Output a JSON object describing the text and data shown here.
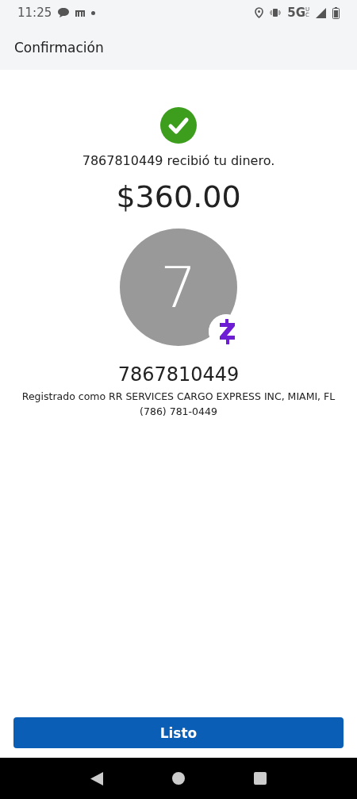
{
  "status_bar": {
    "time": "11:25",
    "network": "5G",
    "network_sub": "UC"
  },
  "app_bar": {
    "title": "Confirmación"
  },
  "confirmation": {
    "message": "7867810449 recibió tu dinero.",
    "amount": "$360.00"
  },
  "recipient": {
    "initial": "7",
    "name": "7867810449",
    "registered": "Registrado como RR SERVICES CARGO EXPRESS INC, MIAMI, FL",
    "phone": "(786) 781-0449"
  },
  "buttons": [
    {
      "label": "Listo",
      "kind": "primary"
    }
  ]
}
